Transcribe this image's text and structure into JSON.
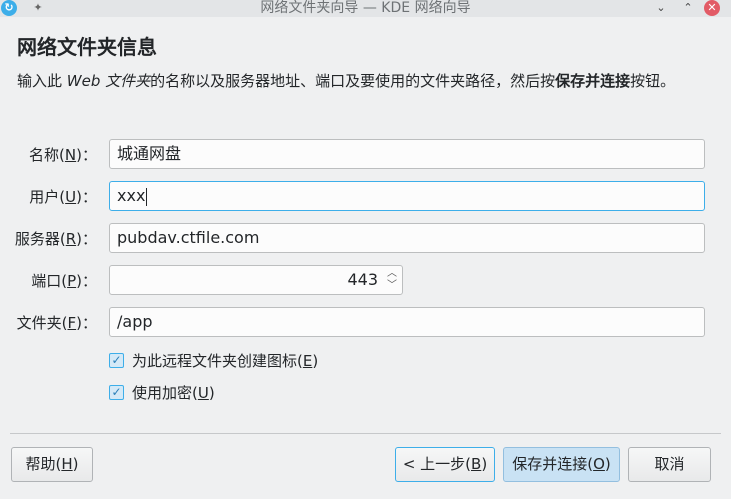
{
  "window": {
    "title": "网络文件夹向导 — KDE 网络向导",
    "app_icon_glyph": "↻",
    "pin_glyph": "✦",
    "minimize_glyph": "⌄",
    "maximize_glyph": "⌃",
    "close_glyph": "✕"
  },
  "page": {
    "heading": "网络文件夹信息",
    "description_prefix": "输入此 ",
    "description_italic": "Web 文件夹",
    "description_middle": "的名称以及服务器地址、端口及要使用的文件夹路径，然后按",
    "description_bold": "保存并连接",
    "description_suffix": "按钮。"
  },
  "form": {
    "name": {
      "label_pre": "名称(",
      "mnemonic": "N",
      "label_post": ")：",
      "value": "城通网盘"
    },
    "user": {
      "label_pre": "用户(",
      "mnemonic": "U",
      "label_post": ")：",
      "value": "xxx"
    },
    "server": {
      "label_pre": "服务器(",
      "mnemonic": "R",
      "label_post": ")：",
      "value": "pubdav.ctfile.com"
    },
    "port": {
      "label_pre": "端口(",
      "mnemonic": "P",
      "label_post": ")：",
      "value": "443"
    },
    "folder": {
      "label_pre": "文件夹(",
      "mnemonic": "F",
      "label_post": ")：",
      "value": "/app"
    },
    "create_icon": {
      "label_pre": "为此远程文件夹创建图标(",
      "mnemonic": "E",
      "label_post": ")",
      "checked": true
    },
    "encryption": {
      "label_pre": "使用加密(",
      "mnemonic": "U",
      "label_post": ")",
      "checked": true
    }
  },
  "buttons": {
    "help": {
      "pre": "帮助(",
      "mnemonic": "H",
      "post": ")"
    },
    "back": {
      "pre": "< 上一步(",
      "mnemonic": "B",
      "post": ")"
    },
    "save_connect": {
      "pre": "保存并连接(",
      "mnemonic": "O",
      "post": ")"
    },
    "cancel": {
      "label": "取消"
    }
  },
  "colors": {
    "accent": "#3daee9",
    "window_bg": "#eff0f1",
    "close_button": "#e25b66"
  }
}
